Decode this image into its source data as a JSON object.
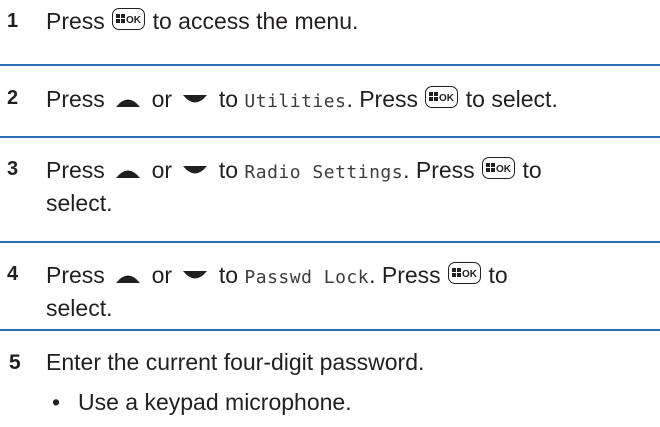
{
  "steps": [
    {
      "number": "1",
      "p1": "Press",
      "p2": "to access the menu."
    },
    {
      "number": "2",
      "p1": "Press",
      "or": "or",
      "to": "to",
      "menu_item": "Utilities",
      "press": ". Press",
      "end": "to select."
    },
    {
      "number": "3",
      "p1": "Press",
      "or": "or",
      "to": "to",
      "menu_item": "Radio Settings",
      "press": ". Press",
      "end": "to",
      "line2": "select."
    },
    {
      "number": "4",
      "p1": "Press",
      "or": "or",
      "to": "to",
      "menu_item": "Passwd Lock",
      "press": ". Press",
      "end": "to",
      "line2": "select."
    },
    {
      "number": "5",
      "p1": "Enter the current four-digit password."
    }
  ],
  "bullets": [
    {
      "marker": "•",
      "text": "Use a keypad microphone."
    }
  ],
  "icons": {
    "menu_ok_key": "menu-ok-key-icon",
    "up_arrow": "up-arrow-icon",
    "down_arrow": "down-arrow-icon"
  },
  "colors": {
    "divider": "#2c6fb4",
    "text": "#231f20"
  }
}
